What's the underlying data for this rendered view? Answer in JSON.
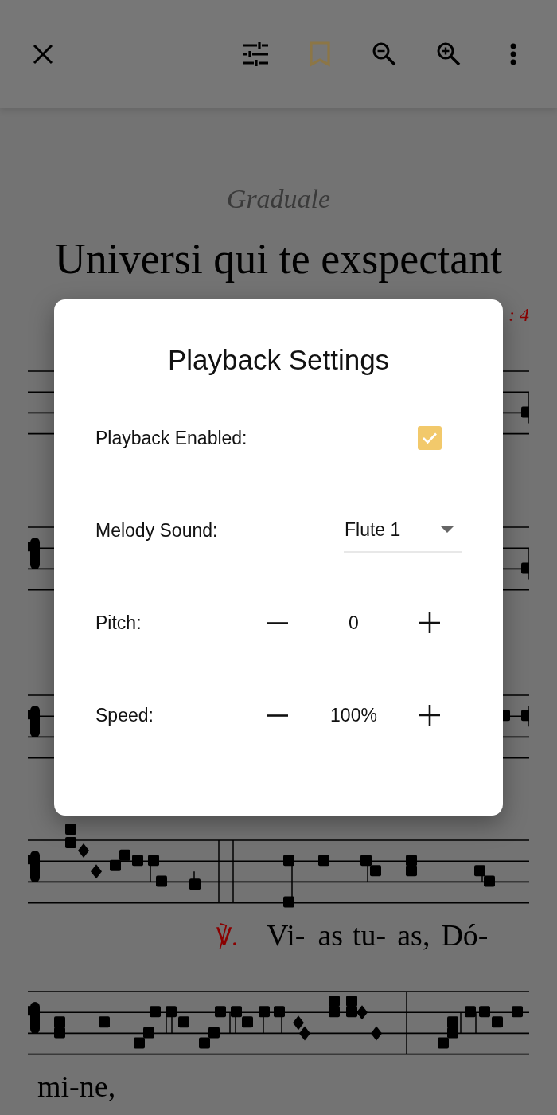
{
  "toolbar": {
    "buttons": [
      {
        "kind": "close"
      },
      {
        "kind": "tune"
      },
      {
        "kind": "bookmark"
      },
      {
        "kind": "zoom-out"
      },
      {
        "kind": "zoom-in"
      },
      {
        "kind": "more"
      }
    ]
  },
  "score": {
    "genre": "Graduale",
    "title": "Universi qui te exspectant",
    "mode": ": 4",
    "verse": {
      "sign": "℣.",
      "syllables": [
        "Vi-",
        "as",
        "tu-",
        "as,",
        "Dó-"
      ]
    },
    "continuation": "mi-ne,"
  },
  "dialog": {
    "title": "Playback Settings",
    "rows": [
      {
        "kind": "checkbox",
        "label": "Playback Enabled:",
        "checked": true
      },
      {
        "kind": "dropdown",
        "label": "Melody Sound:",
        "value": "Flute 1"
      },
      {
        "kind": "stepper",
        "label": "Pitch:",
        "value": "0"
      },
      {
        "kind": "stepper",
        "label": "Speed:",
        "value": "100%"
      }
    ]
  }
}
